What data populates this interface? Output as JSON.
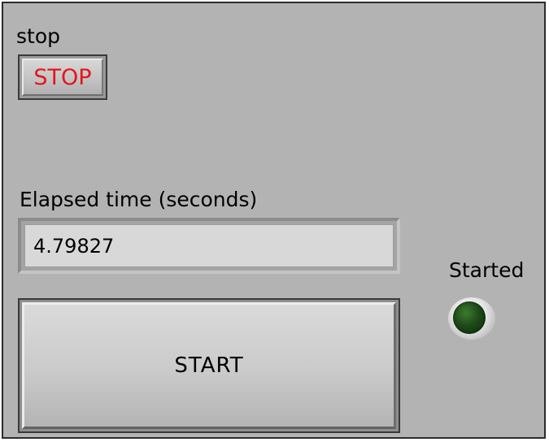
{
  "window": {
    "background_color": "#b3b3b3"
  },
  "stop_control": {
    "label": "stop",
    "button_text": "STOP",
    "text_color": "#e6141c"
  },
  "elapsed_indicator": {
    "label": "Elapsed time (seconds)",
    "value": "4.79827"
  },
  "start_control": {
    "button_text": "START"
  },
  "started_indicator": {
    "label": "Started",
    "state": "off",
    "led_color": "#1d4a17",
    "icon": "led-indicator-icon"
  }
}
